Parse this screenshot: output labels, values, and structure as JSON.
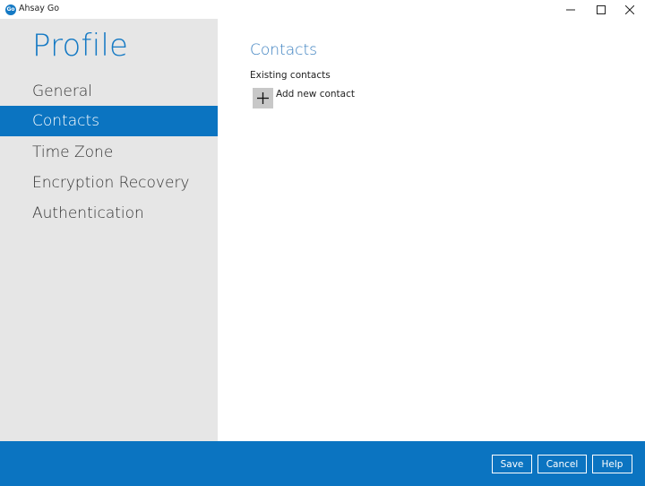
{
  "window": {
    "title": "Ahsay Go",
    "logo_text": "Go",
    "controls": [
      "minimize-icon",
      "maximize-icon",
      "close-icon"
    ]
  },
  "sidebar": {
    "title": "Profile",
    "items": [
      {
        "label": "General",
        "active": false
      },
      {
        "label": "Contacts",
        "active": true
      },
      {
        "label": "Time Zone",
        "active": false
      },
      {
        "label": "Encryption Recovery",
        "active": false
      },
      {
        "label": "Authentication",
        "active": false
      }
    ]
  },
  "main": {
    "title": "Contacts",
    "section_label": "Existing contacts",
    "add_contact_label": "Add new contact",
    "add_icon": "plus-icon"
  },
  "footer": {
    "save_label": "Save",
    "cancel_label": "Cancel",
    "help_label": "Help"
  },
  "colors": {
    "accent": "#0b74c1",
    "title_blue": "#1479c4",
    "sidebar_bg": "#e6e6e6",
    "add_button_bg": "#c8c8c8"
  }
}
